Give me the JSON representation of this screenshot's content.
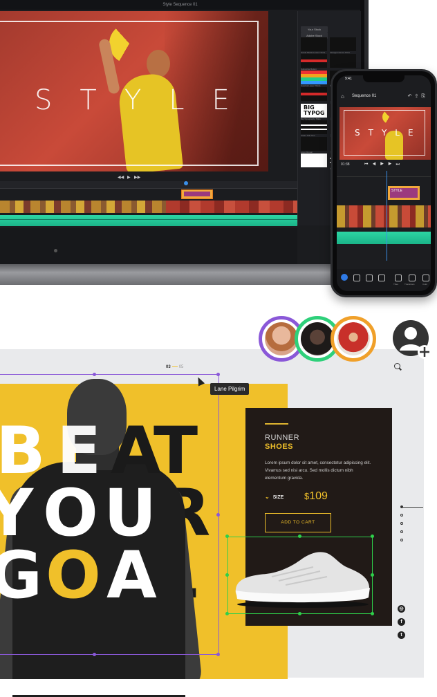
{
  "editor": {
    "window_title": "Style Sequence 01",
    "panel_tabs": [
      "Your Stock",
      "Adobe Stock"
    ],
    "template_labels": [
      "Social Media Lower Thirds",
      "Vintage Frames Titles",
      "Subscribe Button",
      "",
      "Colorful Lower Thirds",
      "Title Card",
      "",
      "",
      "Big Typography Titles",
      "",
      "Clean Title Text",
      "",
      "Logo Reveal",
      "",
      "",
      "Motion Typo Titles"
    ],
    "big_typog_text": "BIG TYPOG",
    "preview_title_text": "STYLE"
  },
  "phone": {
    "time": "9:41",
    "sequence_title": "Sequence 01",
    "preview_title_text": "STYLE",
    "timecode": "01:38",
    "clip_label": "STYLE",
    "toolbar_labels": [
      "",
      "",
      "",
      "",
      "Titles",
      "Transitions",
      "Color"
    ]
  },
  "prototype": {
    "headline_words": [
      "BEAT",
      "YOUR",
      "GOAL"
    ],
    "counter": {
      "current": "03",
      "total": "05"
    },
    "tooltip": "Lane Pilgrim",
    "card": {
      "title_line1": "RUNNER",
      "title_line2": "SHOES",
      "body": "Lorem ipsum dolor sit amet, consectetur adipiscing elit. Vivamus sed nisi arcu. Sed mollis dictum nibh elementum gravida.",
      "size_label": "SIZE",
      "price_currency": "$",
      "price_value": "109",
      "cta": "ADD TO CART"
    },
    "social_icons": [
      "instagram-icon",
      "facebook-icon",
      "twitter-icon"
    ],
    "collaborators": [
      {
        "ring": "#8a58d8",
        "fill": "#d9a48a"
      },
      {
        "ring": "#2ed07a",
        "fill": "#4a3a35"
      },
      {
        "ring": "#f0a02a",
        "fill": "#c8302a"
      }
    ]
  },
  "colors": {
    "accent_yellow": "#f0c02a",
    "card_dark": "#211a17",
    "selection_purple": "#8a58d8",
    "selection_green": "#2ed04a"
  }
}
